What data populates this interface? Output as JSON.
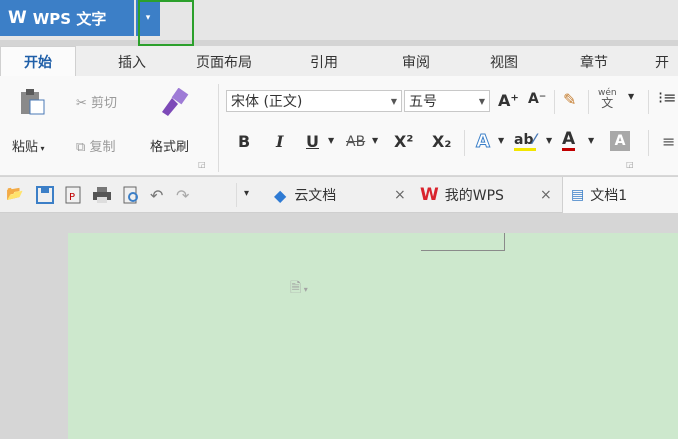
{
  "app": {
    "logo": "W",
    "title": "WPS 文字",
    "dropdown_arrow": "▾"
  },
  "tabs": [
    "开始",
    "插入",
    "页面布局",
    "引用",
    "审阅",
    "视图",
    "章节",
    "开"
  ],
  "clipboard": {
    "paste": "粘贴",
    "cut": "剪切",
    "copy": "复制",
    "format_painter": "格式刷"
  },
  "font": {
    "family": "宋体 (正文)",
    "size": "五号",
    "grow": "A⁺",
    "shrink": "A⁻",
    "bold": "B",
    "italic": "I",
    "underline": "U",
    "strikethrough": "AB",
    "superscript": "X²",
    "subscript": "X₂",
    "text_effect": "A",
    "highlight": "ab",
    "font_color": "A",
    "char_shading": "A",
    "phonetic": "wén"
  },
  "quick_access": {
    "more": "▾"
  },
  "doc_tabs": [
    {
      "label": "云文档",
      "close": "×"
    },
    {
      "label": "我的WPS",
      "close": "×"
    },
    {
      "label": "文档1"
    }
  ],
  "colors": {
    "title_blue": "#3c7fc7",
    "page_green": "#cde8cd",
    "highlight_box": "#2ca02c",
    "wps_red": "#d9232d"
  }
}
